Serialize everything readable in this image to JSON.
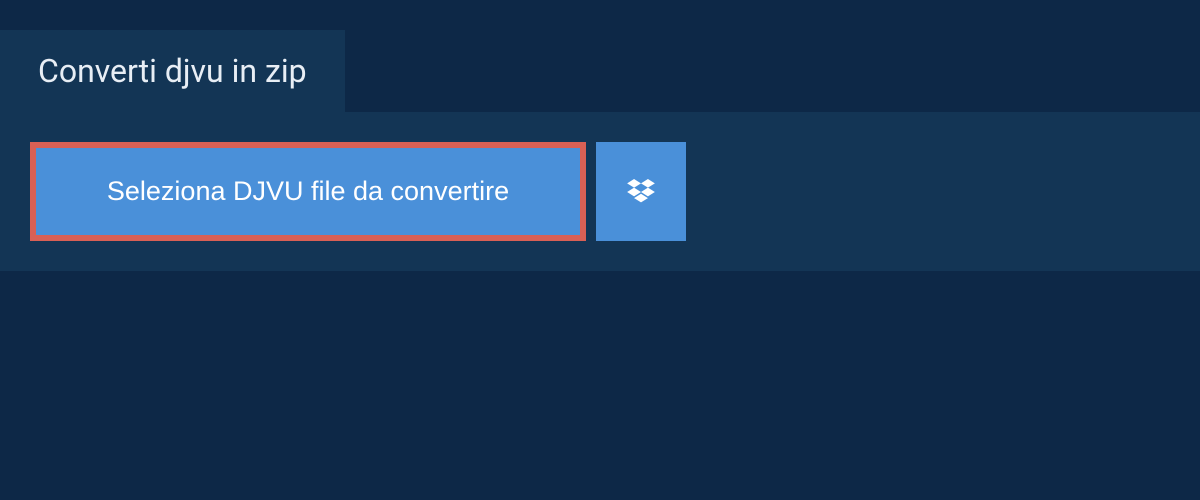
{
  "tab": {
    "title": "Converti djvu in zip"
  },
  "upload": {
    "select_button_label": "Seleziona DJVU file da convertire"
  }
}
